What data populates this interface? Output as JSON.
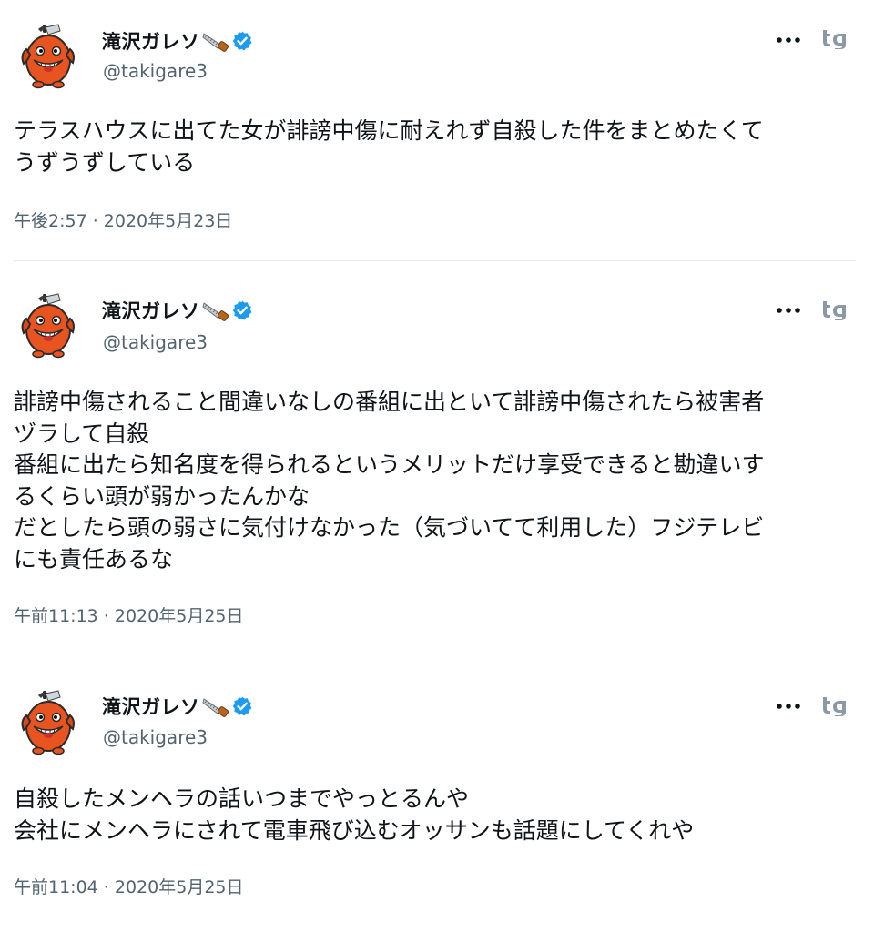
{
  "colors": {
    "text": "#0f1419",
    "secondary": "#536471",
    "verified": "#1d9bf0",
    "avatar_orange": "#e8541f",
    "divider": "#e6e9eb",
    "tg_logo": "#8b98a5"
  },
  "icons": {
    "avatar": "chainsaw-dog-character-avatar",
    "name_emoji": "saw-emoji",
    "verified": "verified-badge-icon",
    "more": "more-options-icon",
    "brand": "tg-logo-icon"
  },
  "tweets": [
    {
      "display_name": "滝沢ガレソ",
      "handle": "@takigare3",
      "text": "テラスハウスに出てた女が誹謗中傷に耐えれず自殺した件をまとめたくて\nうずうずしている",
      "timestamp": "午後2:57 · 2020年5月23日"
    },
    {
      "display_name": "滝沢ガレソ",
      "handle": "@takigare3",
      "text": "誹謗中傷されること間違いなしの番組に出といて誹謗中傷されたら被害者\nヅラして自殺\n番組に出たら知名度を得られるというメリットだけ享受できると勘違いす\nるくらい頭が弱かったんかな\nだとしたら頭の弱さに気付けなかった（気づいてて利用した）フジテレビ\nにも責任あるな",
      "timestamp": "午前11:13 · 2020年5月25日"
    },
    {
      "display_name": "滝沢ガレソ",
      "handle": "@takigare3",
      "text": "自殺したメンヘラの話いつまでやっとるんや\n会社にメンヘラにされて電車飛び込むオッサンも話題にしてくれや",
      "timestamp": "午前11:04 · 2020年5月25日"
    }
  ]
}
